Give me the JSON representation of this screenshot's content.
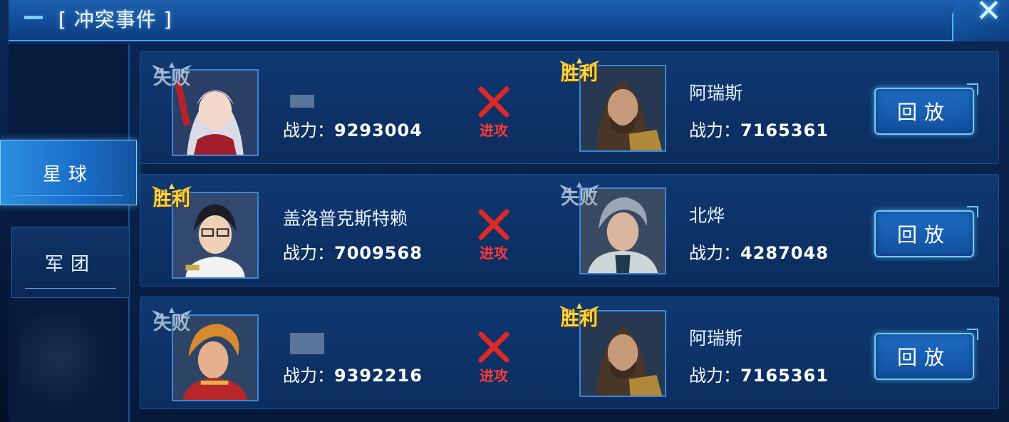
{
  "header": {
    "title": "[ 冲突事件 ]"
  },
  "sidebar": {
    "tabs": [
      {
        "label": "星球",
        "active": true
      },
      {
        "label": "军团",
        "active": false
      }
    ]
  },
  "colors": {
    "win": "#ffd64a",
    "lose": "#a9c3de",
    "attack": "#ff3a3a",
    "accent": "#6ccbff"
  },
  "rows": [
    {
      "left": {
        "result": "失败",
        "name": "",
        "power_label": "战力：",
        "power": "9293004"
      },
      "action": "进攻",
      "right": {
        "result": "胜利",
        "name": "阿瑞斯",
        "power_label": "战力：",
        "power": "7165361"
      },
      "replay": "回放"
    },
    {
      "left": {
        "result": "胜利",
        "name": "盖洛普克斯特赖",
        "power_label": "战力：",
        "power": "7009568"
      },
      "action": "进攻",
      "right": {
        "result": "失败",
        "name": "北烨",
        "power_label": "战力：",
        "power": "4287048"
      },
      "replay": "回放"
    },
    {
      "left": {
        "result": "失败",
        "name": "",
        "power_label": "战力：",
        "power": "9392216"
      },
      "action": "进攻",
      "right": {
        "result": "胜利",
        "name": "阿瑞斯",
        "power_label": "战力：",
        "power": "7165361"
      },
      "replay": "回放"
    }
  ]
}
